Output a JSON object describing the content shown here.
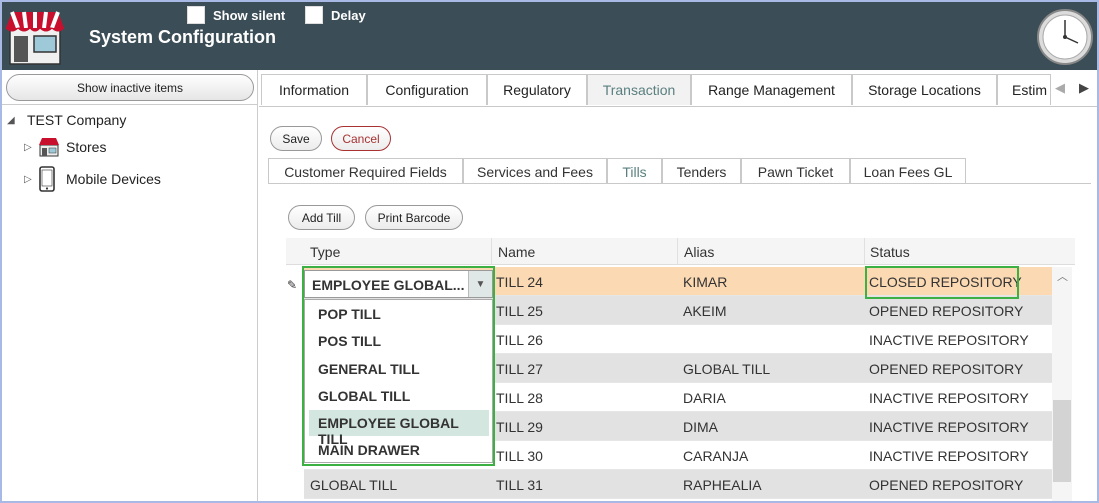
{
  "header": {
    "title": "System Configuration",
    "show_silent_label": "Show silent",
    "delay_label": "Delay"
  },
  "left": {
    "show_inactive_label": "Show inactive items",
    "company": "TEST Company",
    "stores": "Stores",
    "mobile_devices": "Mobile Devices"
  },
  "tabs": [
    "Information",
    "Configuration",
    "Regulatory",
    "Transaction",
    "Range Management",
    "Storage Locations",
    "Estim"
  ],
  "active_tab": "Transaction",
  "actions": {
    "save": "Save",
    "cancel": "Cancel"
  },
  "subtabs": [
    "Customer Required Fields",
    "Services and Fees",
    "Tills",
    "Tenders",
    "Pawn Ticket",
    "Loan Fees GL"
  ],
  "active_subtab": "Tills",
  "till_actions": {
    "add_till": "Add Till",
    "print_barcode": "Print Barcode"
  },
  "grid": {
    "columns": [
      "Type",
      "Name",
      "Alias",
      "Status"
    ],
    "rows": [
      {
        "type": "EMPLOYEE GLOBAL...",
        "name": "TILL 24",
        "alias": "KIMAR",
        "status": "CLOSED REPOSITORY"
      },
      {
        "type": "",
        "name": "TILL 25",
        "alias": "AKEIM",
        "status": "OPENED REPOSITORY"
      },
      {
        "type": "",
        "name": "TILL 26",
        "alias": "",
        "status": "INACTIVE REPOSITORY"
      },
      {
        "type": "",
        "name": "TILL 27",
        "alias": "GLOBAL TILL",
        "status": "OPENED REPOSITORY"
      },
      {
        "type": "",
        "name": "TILL 28",
        "alias": "DARIA",
        "status": "INACTIVE REPOSITORY"
      },
      {
        "type": "",
        "name": "TILL 29",
        "alias": "DIMA",
        "status": "INACTIVE REPOSITORY"
      },
      {
        "type": "",
        "name": "TILL 30",
        "alias": "CARANJA",
        "status": "INACTIVE REPOSITORY"
      },
      {
        "type": "GLOBAL TILL",
        "name": "TILL 31",
        "alias": "RAPHEALIA",
        "status": "OPENED REPOSITORY"
      }
    ]
  },
  "dropdown": {
    "selected": "EMPLOYEE GLOBAL...",
    "options": [
      "POP TILL",
      "POS TILL",
      "GENERAL TILL",
      "GLOBAL TILL",
      "EMPLOYEE GLOBAL TILL",
      "MAIN DRAWER"
    ],
    "highlighted": "EMPLOYEE GLOBAL TILL"
  },
  "colors": {
    "header_bg": "#3b4d56",
    "selected_row": "#fad9b3",
    "highlight_box": "#3cb043",
    "cancel": "#a83232"
  }
}
